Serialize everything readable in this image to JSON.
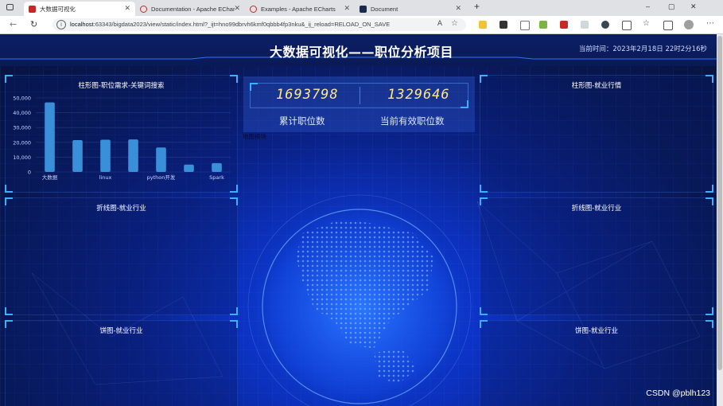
{
  "browser": {
    "tabs": [
      {
        "label": "大数据可视化",
        "active": true,
        "color": "#c62828"
      },
      {
        "label": "Documentation - Apache ECharts",
        "active": false,
        "color": "#c62828"
      },
      {
        "label": "Examples - Apache ECharts",
        "active": false,
        "color": "#c62828"
      },
      {
        "label": "Document",
        "active": false,
        "color": "#0b57d0"
      }
    ],
    "new_tab": "+",
    "url_host": "localhost",
    "url_rest": ":63343/bigdata2023/view/static/index.html?_ijt=hno99dbrvh6kmf0qbbb4fp3nku&_ij_reload=RELOAD_ON_SAVE",
    "reader_label": "A",
    "window_controls": [
      "–",
      "▢",
      "✕"
    ]
  },
  "page": {
    "title": "大数据可视化——职位分析项目",
    "time": "当前时间：2023年2月18日 22时2分16秒",
    "total_jobs": "1693798",
    "active_jobs": "1329646",
    "total_jobs_label": "累计职位数",
    "active_jobs_label": "当前有效职位数",
    "map_label": "地图模块"
  },
  "panels": {
    "bar_left": "柱形图-职位需求-关键词搜索",
    "bar_right": "柱形图-就业行情",
    "line_left": "折线图-就业行业",
    "line_right": "折线图-就业行业",
    "pie_left": "饼图-就业行业",
    "pie_right": "饼图-就业行业"
  },
  "chart_data": {
    "type": "bar",
    "title": "柱形图-职位需求-关键词搜索",
    "categories": [
      "大数据",
      "",
      "linux",
      "",
      "python开发",
      "",
      "Spark"
    ],
    "values": [
      47000,
      21500,
      21800,
      22000,
      16500,
      5000,
      6000
    ],
    "ylim": [
      0,
      50000
    ],
    "yticks": [
      "0",
      "10,000",
      "20,000",
      "30,000",
      "40,000",
      "50,000"
    ],
    "bar_color": "#3a8fd9",
    "grid": true
  },
  "watermark": "CSDN @pblh123"
}
